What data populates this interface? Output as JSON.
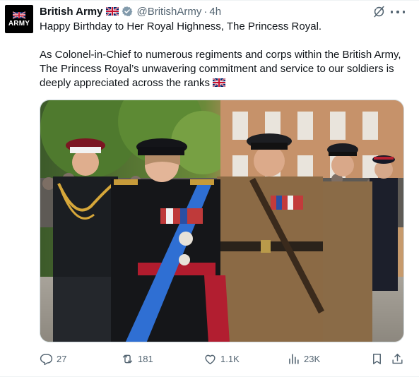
{
  "tweet": {
    "author_name": "British Army",
    "handle": "@BritishArmy",
    "separator": "·",
    "time": "4h",
    "avatar_label": "ARMY",
    "paragraph1": "Happy Birthday to Her Royal Highness, The Princess Royal.",
    "paragraph2": "As Colonel-in-Chief to numerous regiments and corps within the British Army, The Princess Royal’s unwavering commitment and service to our soldiers is deeply appreciated across the ranks"
  },
  "actions": {
    "replies": "27",
    "reposts": "181",
    "likes": "1.1K",
    "views": "23K"
  },
  "icons": {
    "verified": "verified-badge-icon",
    "grok": "grok-icon",
    "more": "more-icon",
    "reply": "reply-icon",
    "repost": "repost-icon",
    "like": "like-icon",
    "views": "views-icon",
    "bookmark": "bookmark-icon",
    "share": "share-icon"
  },
  "colors": {
    "text": "#0f1419",
    "muted": "#536471",
    "verified": "#829aab",
    "border": "#cfd9de"
  }
}
